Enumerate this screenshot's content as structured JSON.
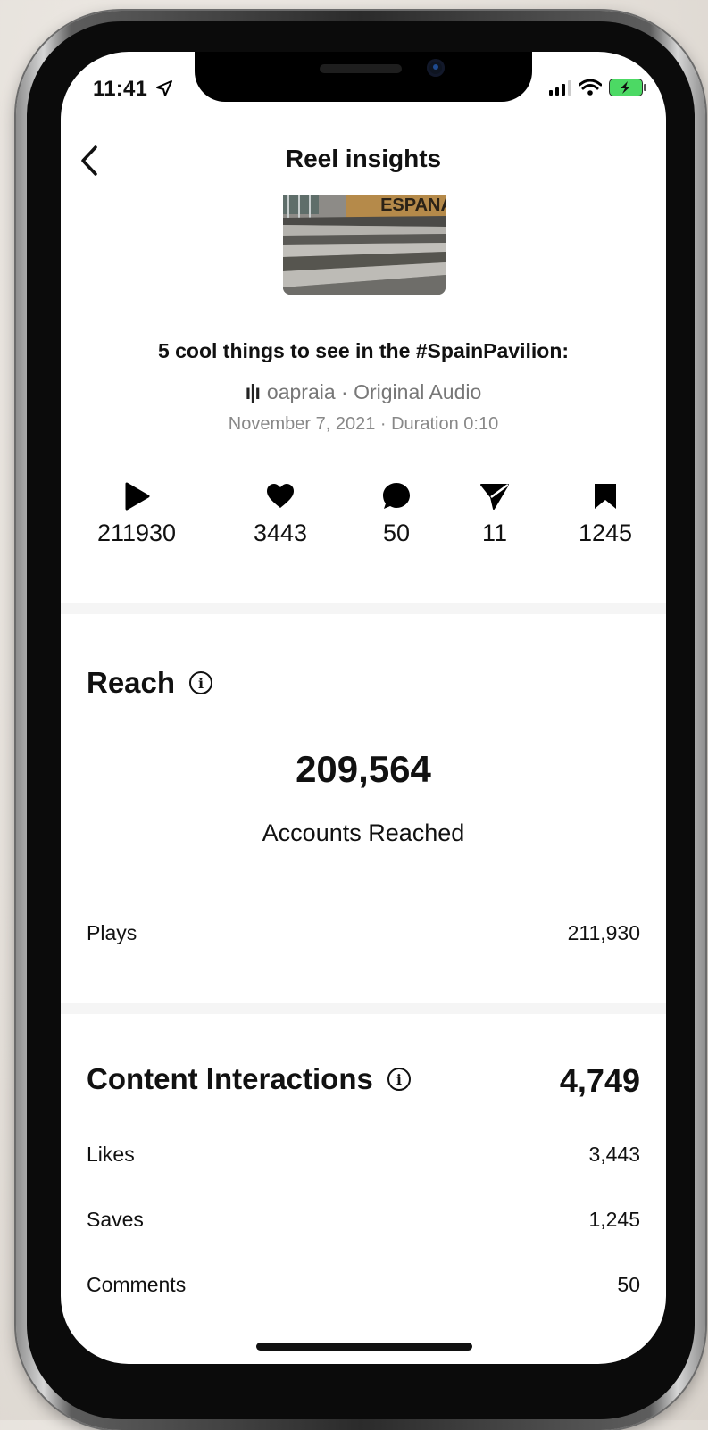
{
  "status_bar": {
    "time": "11:41"
  },
  "nav": {
    "title": "Reel insights"
  },
  "reel": {
    "title": "5 cool things to see in the #SpainPavilion:",
    "audio": "oapraia · Original Audio",
    "meta": "November 7, 2021 · Duration 0:10",
    "thumbnail_sign_text": "ESPANA"
  },
  "stats": [
    {
      "icon": "play-icon",
      "value": "211930"
    },
    {
      "icon": "heart-icon",
      "value": "3443"
    },
    {
      "icon": "comment-icon",
      "value": "50"
    },
    {
      "icon": "share-icon",
      "value": "11"
    },
    {
      "icon": "bookmark-icon",
      "value": "1245"
    }
  ],
  "reach": {
    "heading": "Reach",
    "accounts_value": "209,564",
    "accounts_label": "Accounts Reached",
    "plays_label": "Plays",
    "plays_value": "211,930"
  },
  "content_interactions": {
    "heading": "Content Interactions",
    "total": "4,749",
    "rows": [
      {
        "label": "Likes",
        "value": "3,443"
      },
      {
        "label": "Saves",
        "value": "1,245"
      },
      {
        "label": "Comments",
        "value": "50"
      }
    ]
  }
}
